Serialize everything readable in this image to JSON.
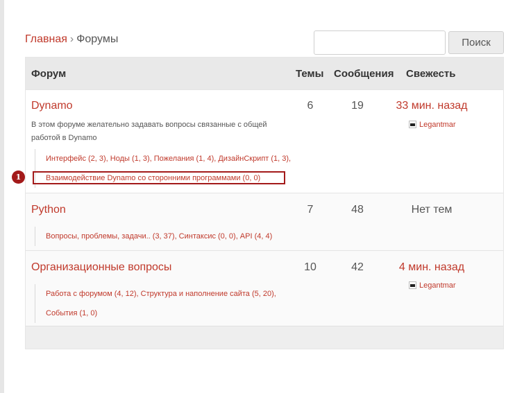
{
  "breadcrumb": {
    "home": "Главная",
    "separator": "›",
    "current": "Форумы"
  },
  "search": {
    "value": "",
    "placeholder": "",
    "button_label": "Поиск"
  },
  "table": {
    "headers": {
      "forum": "Форум",
      "topics": "Темы",
      "posts": "Сообщения",
      "freshness": "Свежесть"
    },
    "rows": [
      {
        "title": "Dynamo",
        "topics": "6",
        "posts": "19",
        "freshness": "33 мин. назад",
        "user": "Legantmar",
        "description": "В этом форуме желательно задавать вопросы связанные с общей работой в Dynamo",
        "subforums_line1": "Интерфейс (2, 3), Ноды (1, 3), Пожелания (1, 4), ДизайнСкрипт (1, 3),",
        "subforums_line2": "Взаимодействие Dynamo со сторонними программами (0, 0)"
      },
      {
        "title": "Python",
        "topics": "7",
        "posts": "48",
        "freshness": "Нет тем",
        "subforums_line1": "Вопросы, проблемы, задачи.. (3, 37), Синтаксис (0, 0), API (4, 4)"
      },
      {
        "title": "Организационные вопросы",
        "topics": "10",
        "posts": "42",
        "freshness": "4 мин. назад",
        "user": "Legantmar",
        "subforums_line1": "Работа с форумом (4, 12), Структура и наполнение сайта (5, 20),",
        "subforums_line2": "События (1, 0)"
      }
    ]
  },
  "annotation": {
    "marker_label": "1"
  },
  "colors": {
    "accent": "#c0392b",
    "marker": "#a31a1a",
    "header_bg": "#e9e9e9"
  }
}
